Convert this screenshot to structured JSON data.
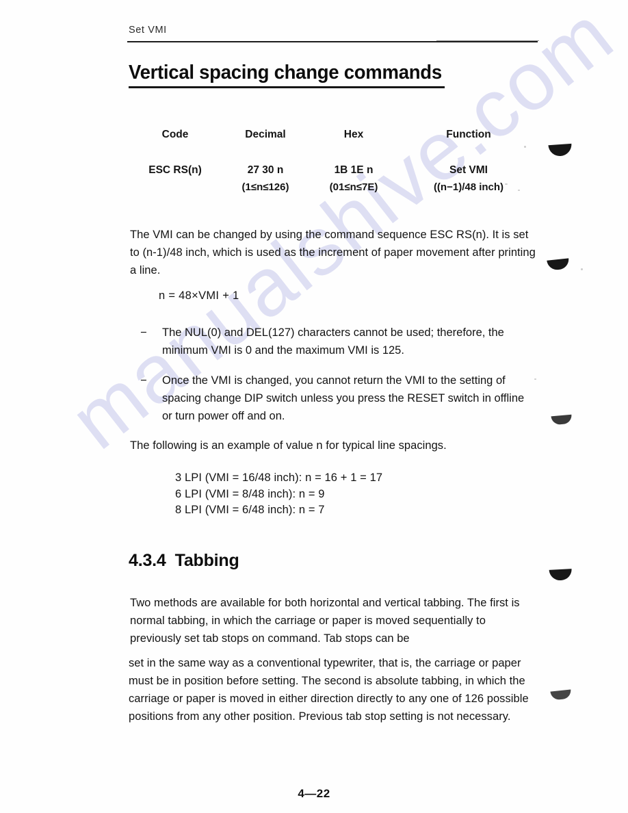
{
  "header": {
    "running_head": "Set VMI"
  },
  "title": "Vertical spacing change commands",
  "command_table": {
    "columns": [
      "Code",
      "Decimal",
      "Hex",
      "Function"
    ],
    "rows": [
      {
        "code": "ESC RS(n)",
        "decimal": "27 30 n",
        "decimal_range": "(1≤n≤126)",
        "hex": "1B 1E n",
        "hex_range": "(01≤n≤7E)",
        "function": "Set VMI",
        "function_detail": "((n−1)/48 inch)"
      }
    ]
  },
  "body": {
    "intro_paragraph": "The VMI can be changed by using the command sequence ESC RS(n). It is set to (n-1)/48 inch, which is used as the increment of paper movement after printing a line.",
    "formula": "n = 48×VMI + 1",
    "bullets": [
      {
        "dash": "−",
        "text": "The NUL(0) and DEL(127) characters cannot be used; therefore, the minimum VMI is 0 and the maximum VMI is 125."
      },
      {
        "dash": "−",
        "text": "Once the VMI is changed, you cannot return the VMI to the setting of spacing change DIP switch unless you press the RESET switch in offline or turn power off and on."
      }
    ],
    "example_intro": "The following is an example of value n for typical line spacings.",
    "examples": [
      "3 LPI (VMI = 16/48 inch): n = 16 + 1 = 17",
      "6 LPI (VMI = 8/48 inch): n = 9",
      "8 LPI (VMI = 6/48 inch): n = 7"
    ]
  },
  "section": {
    "number": "4.3.4",
    "heading": "Tabbing",
    "paragraph_1": "Two methods are available for both horizontal and vertical tabbing. The first is normal tabbing, in which the carriage or paper is moved sequentially to previously set tab stops on command. Tab stops can be",
    "paragraph_2": "set in the same way as a conventional typewriter, that is, the carriage or paper must be in position before setting. The second is absolute tabbing, in which the carriage or paper is moved in either direction directly to any one of 126 possible positions from any other position. Previous tab stop setting is not necessary."
  },
  "footer": {
    "page_number": "4—22"
  },
  "watermark": {
    "text": "manualshive.com"
  }
}
